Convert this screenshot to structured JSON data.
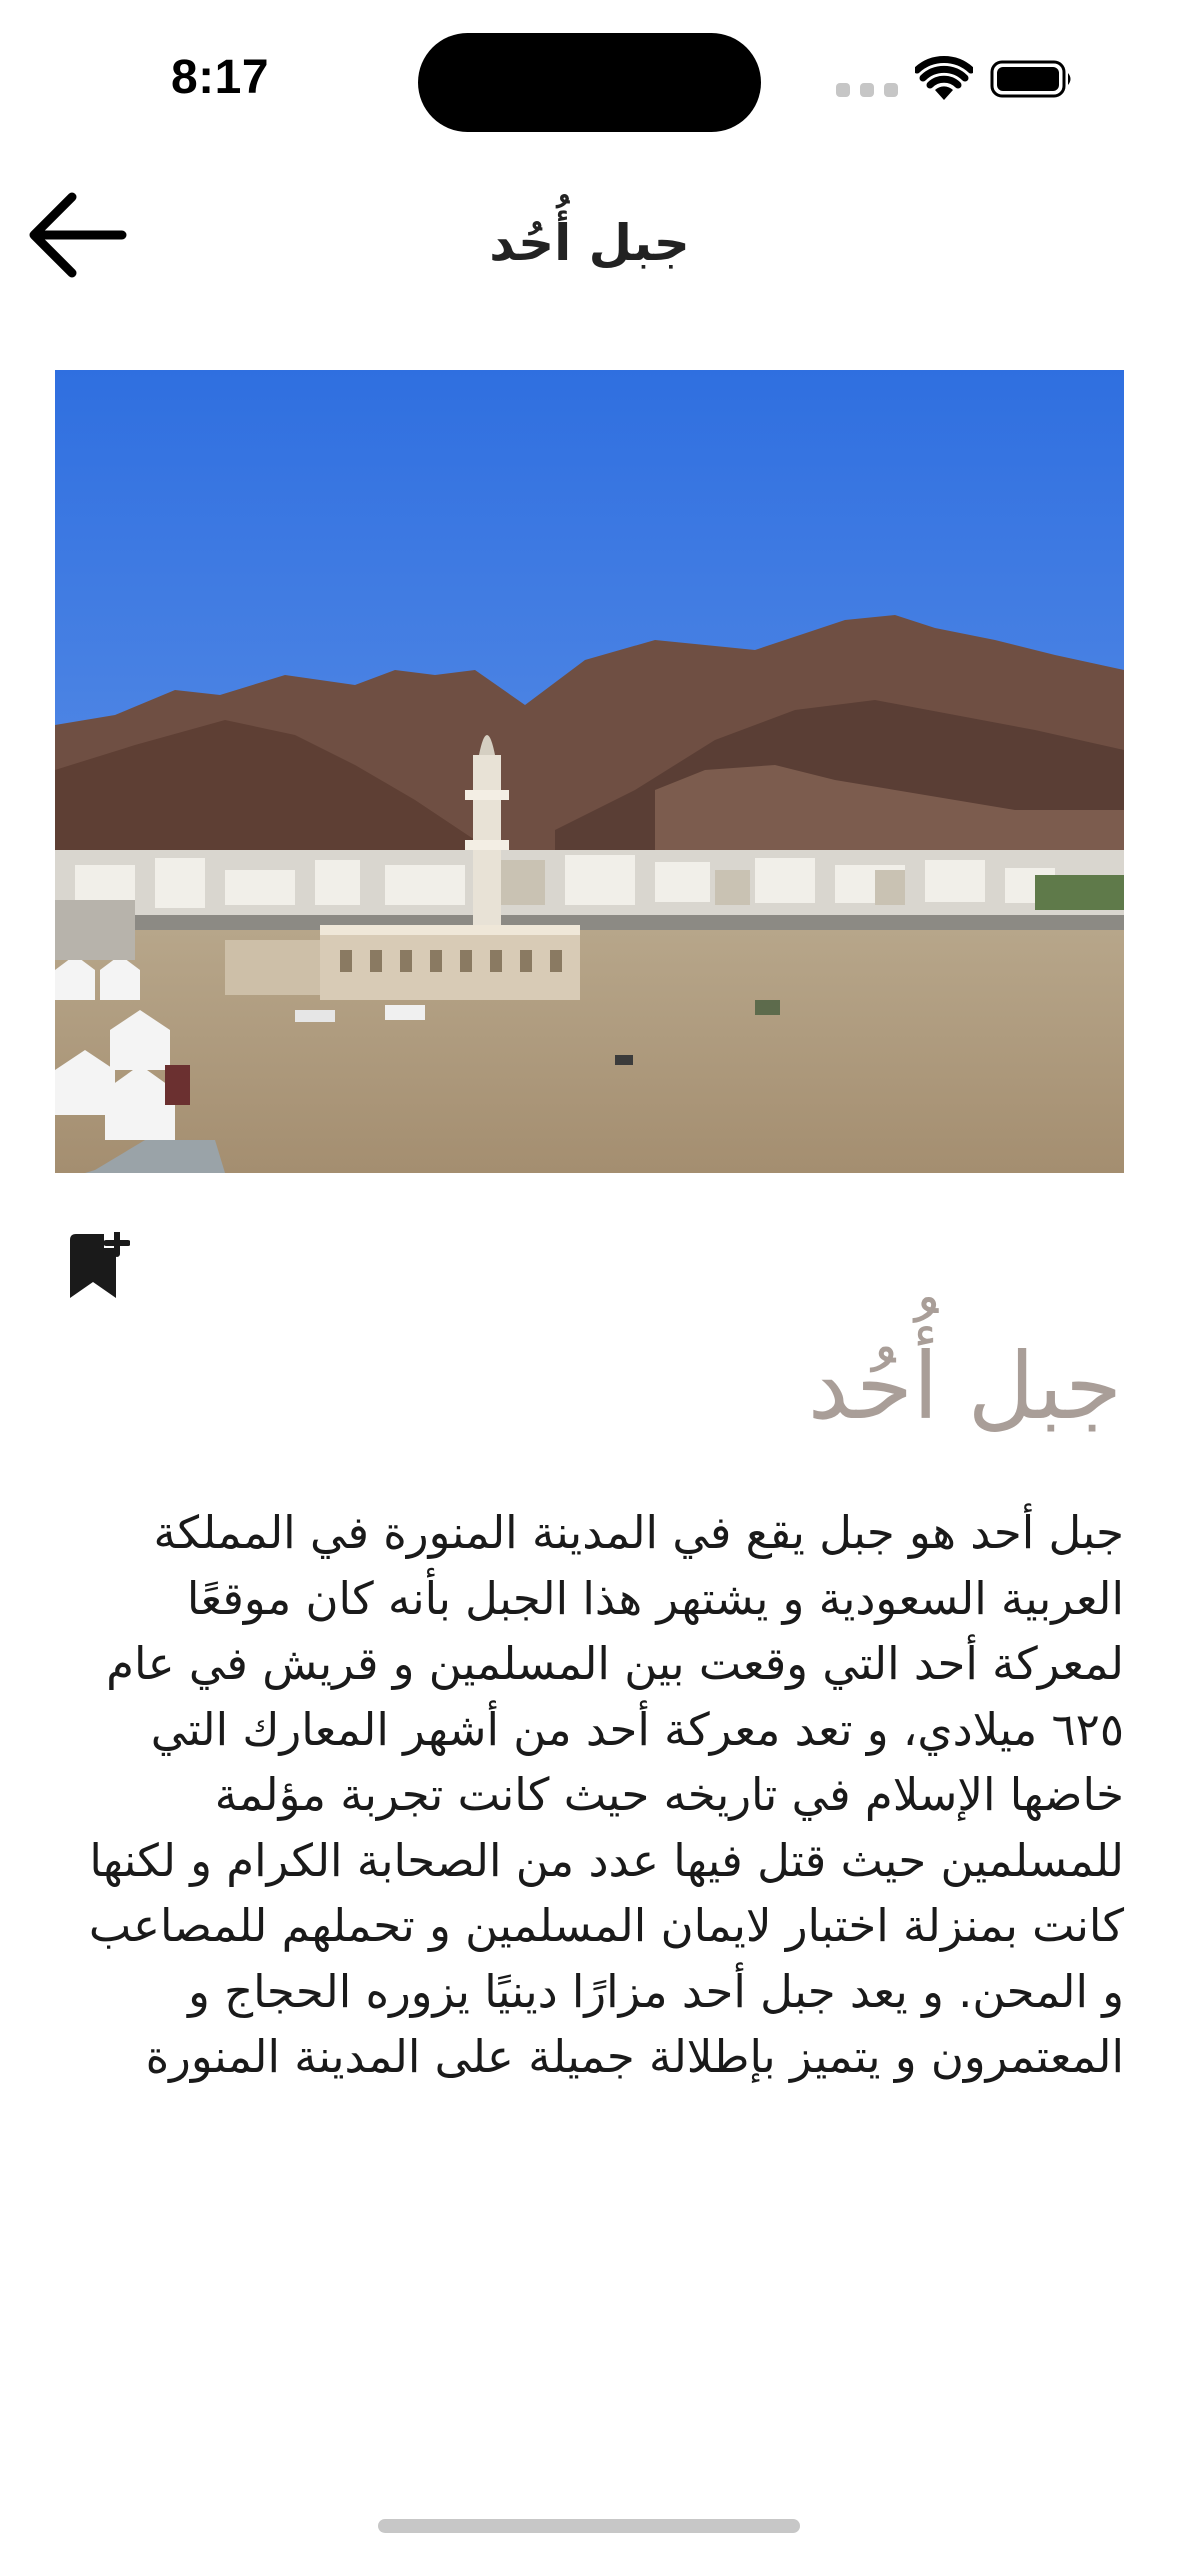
{
  "status_bar": {
    "time": "8:17"
  },
  "header": {
    "title": "جبل أُحُد",
    "back_icon": "arrow-left-icon"
  },
  "hero_image": {
    "subject": "Mount Uhud landscape photo"
  },
  "bookmark": {
    "icon": "bookmark-add-icon"
  },
  "content": {
    "title": "جبل أُحُد",
    "description": "جبل أحد هو جبل يقع في المدينة المنورة في المملكة العربية السعودية و يشتهر هذا الجبل بأنه كان موقعًا لمعركة أحد التي وقعت بين المسلمين و قريش في عام ٦٢٥ ميلادي، و تعد معركة أحد من أشهر المعارك التي خاضها الإسلام في تاريخه حيث كانت تجربة مؤلمة للمسلمين حيث قتل فيها عدد من الصحابة الكرام و لكنها كانت بمنزلة اختبار لايمان المسلمين و تحملهم للمصاعب و المحن. و يعد جبل أحد مزارًا دينيًا يزوره الحجاج و المعتمرون و يتميز بإطلالة جميلة على المدينة المنورة"
  },
  "colors": {
    "title_accent": "#a99e98",
    "sky": "#4a7fe0",
    "mountain": "#6b4a3c"
  }
}
